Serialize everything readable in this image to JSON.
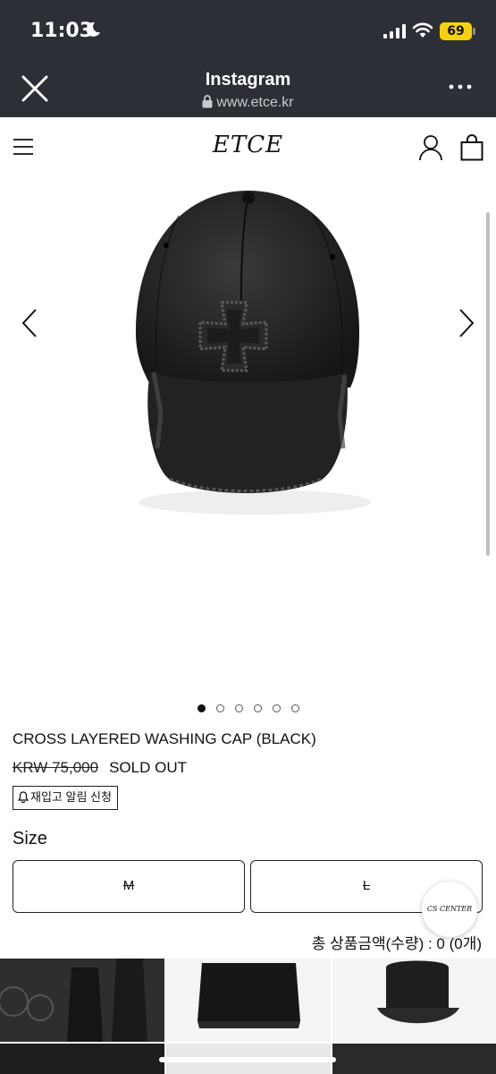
{
  "status_bar": {
    "time": "11:03",
    "battery": "69"
  },
  "browser": {
    "title": "Instagram",
    "url": "www.etce.kr"
  },
  "site": {
    "logo": "ETCE"
  },
  "product": {
    "name": "CROSS LAYERED WASHING CAP (BLACK)",
    "price": "KRW 75,000",
    "status": "SOLD OUT",
    "restock_label": "재입고 알림 신청",
    "image_count": 6,
    "active_image": 1
  },
  "size": {
    "label": "Size",
    "options": [
      "M",
      "L"
    ]
  },
  "cs_badge": "CS CENTER",
  "total_label": "총 상품금액(수량) : 0 (0개)"
}
